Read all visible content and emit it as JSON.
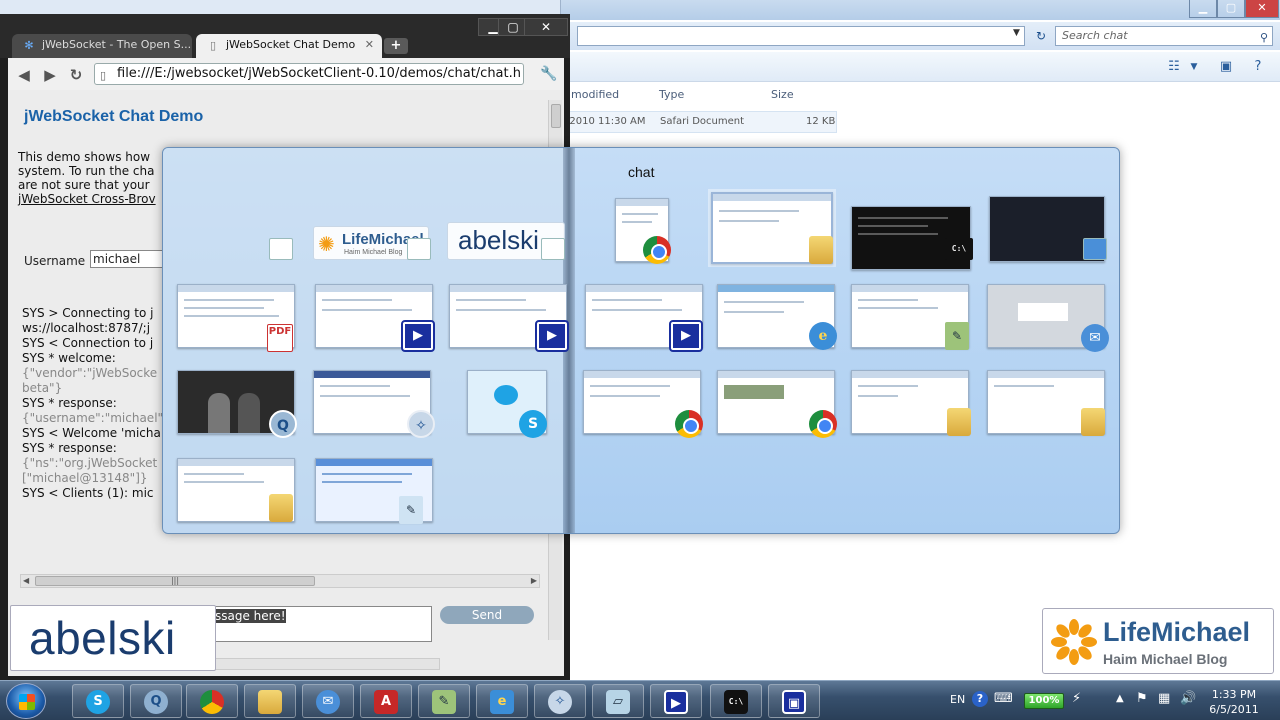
{
  "explorer": {
    "search_placeholder": "Search chat",
    "columns": {
      "modified": "modified",
      "type": "Type",
      "size": "Size"
    },
    "file": {
      "date": "/2010 11:30 AM",
      "type": "Safari Document",
      "size": "12 KB"
    }
  },
  "browser": {
    "tabs": [
      {
        "label": "jWebSocket - The Open S..."
      },
      {
        "label": "jWebSocket Chat Demo"
      }
    ],
    "new_tab": "+",
    "window_controls": {
      "minimize": "▁",
      "maximize": "▢",
      "close": "✕"
    },
    "url": "file:///E:/jwebsocket/jWebSocketClient-0.10/demos/chat/chat.h",
    "page": {
      "title": "jWebSocket Chat Demo",
      "intro_lines": [
        "This demo shows how",
        "system. To run the cha",
        "are not sure that your"
      ],
      "intro_link": "jWebSocket Cross-Brov",
      "username_label": "Username",
      "username_value": "michael",
      "log_lines": [
        "SYS > Connecting to j",
        "ws://localhost:8787/;j",
        "SYS < Connection to j",
        "SYS * welcome:",
        "{\"vendor\":\"jWebSocke",
        "beta\"}",
        "SYS * response:",
        "{\"username\":\"michael\"",
        "SYS < Welcome 'micha",
        "SYS * response:",
        "{\"ns\":\"org.jWebSocket",
        "[\"michael@13148\"]}",
        "SYS < Clients (1): mic"
      ],
      "message_value": "ssage here!",
      "send_label": "Send"
    }
  },
  "flip": {
    "folder_label": "chat",
    "left_logo_lifemichael": "LifeMichael",
    "left_logo_lifemichael_sub": "Haim Michael Blog",
    "left_logo_abelski": "abelski"
  },
  "watermarks": {
    "abelski": "abelski",
    "lifemichael_title": "LifeMichael",
    "lifemichael_sub": "Haim Michael Blog"
  },
  "taskbar": {
    "language": "EN",
    "battery": "100%",
    "time": "1:33 PM",
    "date": "6/5/2011"
  },
  "colors": {
    "page_title": "#1a62a8",
    "flip_bg": "#aacdf1",
    "taskbar": "#37506d"
  }
}
